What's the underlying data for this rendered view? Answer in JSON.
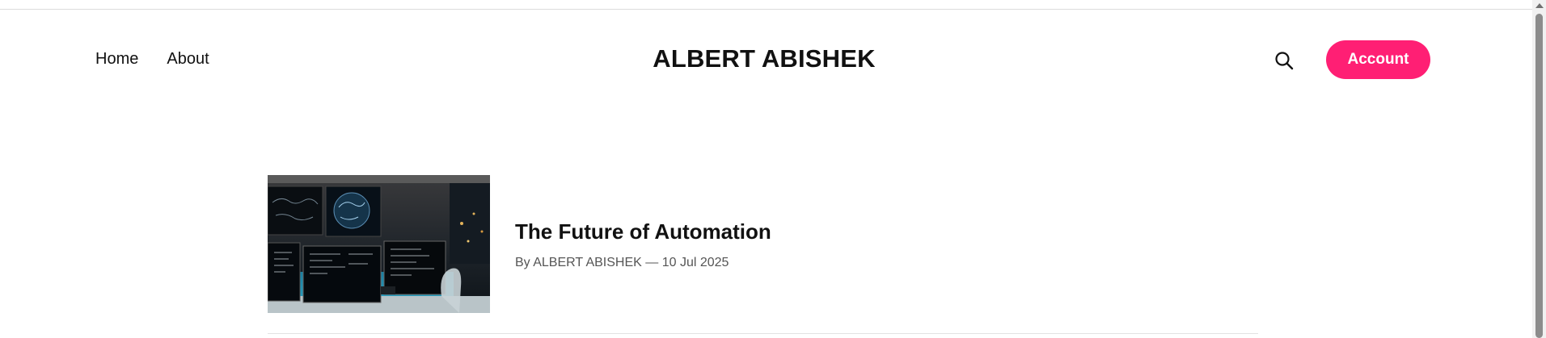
{
  "header": {
    "nav": [
      {
        "label": "Home"
      },
      {
        "label": "About"
      }
    ],
    "site_title": "ALBERT ABISHEK",
    "search_icon": "search-icon",
    "account_label": "Account",
    "accent_color": "#ff1f74"
  },
  "posts": [
    {
      "title": "The Future of Automation",
      "meta": "By ALBERT ABISHEK — 10 Jul 2025",
      "image": "computer-monitors-photo"
    }
  ]
}
